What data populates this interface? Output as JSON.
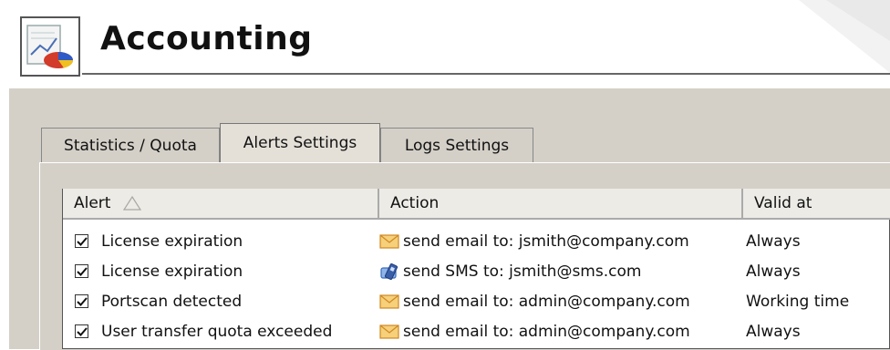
{
  "header": {
    "title": "Accounting"
  },
  "tabs": [
    {
      "label": "Statistics / Quota",
      "active": false
    },
    {
      "label": "Alerts Settings",
      "active": true
    },
    {
      "label": "Logs Settings",
      "active": false
    }
  ],
  "table": {
    "columns": [
      "Alert",
      "Action",
      "Valid at"
    ],
    "sort": {
      "column": "Alert",
      "direction": "ascending"
    },
    "rows": [
      {
        "checked": true,
        "alert": "License expiration",
        "action_icon": "envelope-icon",
        "action": "send email to: jsmith@company.com",
        "valid_at": "Always"
      },
      {
        "checked": true,
        "alert": "License expiration",
        "action_icon": "sms-phone-icon",
        "action": "send SMS to: jsmith@sms.com",
        "valid_at": "Always"
      },
      {
        "checked": true,
        "alert": "Portscan detected",
        "action_icon": "envelope-icon",
        "action": "send email to: admin@company.com",
        "valid_at": "Working time"
      },
      {
        "checked": true,
        "alert": "User transfer quota exceeded",
        "action_icon": "envelope-icon",
        "action": "send email to: admin@company.com",
        "valid_at": "Always"
      }
    ]
  }
}
